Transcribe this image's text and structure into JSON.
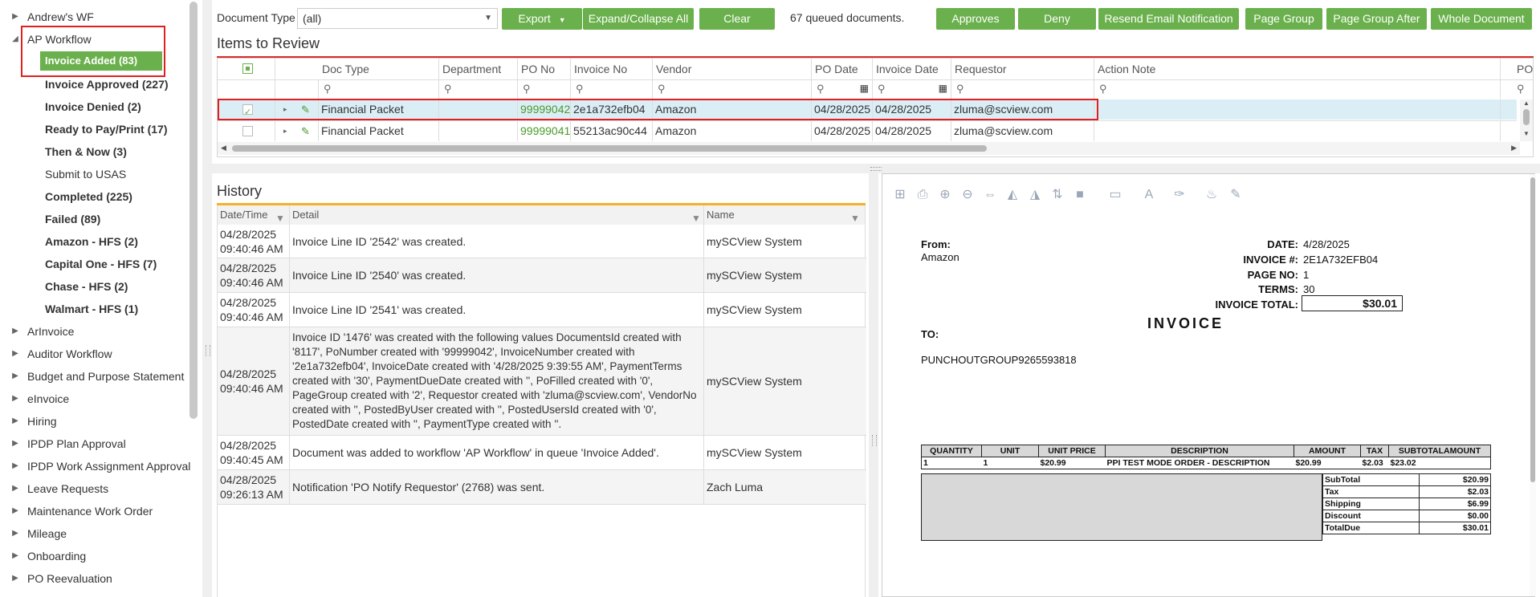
{
  "sidebar": {
    "items": [
      {
        "label": "Andrew's WF",
        "state": "collapsed"
      },
      {
        "label": "AP Workflow",
        "state": "expanded"
      },
      {
        "label": "ArInvoice",
        "state": "collapsed"
      },
      {
        "label": "Auditor Workflow",
        "state": "collapsed"
      },
      {
        "label": "Budget and Purpose Statement",
        "state": "collapsed"
      },
      {
        "label": "eInvoice",
        "state": "collapsed"
      },
      {
        "label": "Hiring",
        "state": "collapsed"
      },
      {
        "label": "IPDP Plan Approval",
        "state": "collapsed"
      },
      {
        "label": "IPDP Work Assignment Approval",
        "state": "collapsed"
      },
      {
        "label": "Leave Requests",
        "state": "collapsed"
      },
      {
        "label": "Maintenance Work Order",
        "state": "collapsed"
      },
      {
        "label": "Mileage",
        "state": "collapsed"
      },
      {
        "label": "Onboarding",
        "state": "collapsed"
      },
      {
        "label": "PO Reevaluation",
        "state": "collapsed"
      }
    ],
    "queues": [
      {
        "label": "Invoice Added (83)",
        "selected": true
      },
      {
        "label": "Invoice Approved (227)"
      },
      {
        "label": "Invoice Denied (2)"
      },
      {
        "label": "Ready to Pay/Print (17)"
      },
      {
        "label": "Then & Now (3)"
      },
      {
        "label": "Submit to USAS"
      },
      {
        "label": "Completed (225)"
      },
      {
        "label": "Failed (89)"
      },
      {
        "label": "Amazon - HFS (2)"
      },
      {
        "label": "Capital One - HFS (7)"
      },
      {
        "label": "Chase - HFS (2)"
      },
      {
        "label": "Walmart - HFS (1)"
      }
    ]
  },
  "toolbar": {
    "doc_type_label": "Document Type",
    "doc_type_value": "(all)",
    "export_label": "Export",
    "expand_label": "Expand/Collapse All",
    "clear_label": "Clear",
    "queued_text": "67 queued documents.",
    "approves_label": "Approves",
    "deny_label": "Deny",
    "resend_label": "Resend Email Notification",
    "page_group_label": "Page Group",
    "page_group_after_label": "Page Group After",
    "whole_document_label": "Whole Document"
  },
  "review": {
    "title": "Items to Review",
    "columns": [
      "Doc Type",
      "Department",
      "PO No",
      "Invoice No",
      "Vendor",
      "PO Date",
      "Invoice Date",
      "Requestor",
      "Action Note",
      "PO"
    ],
    "rows": [
      {
        "doc_type": "Financial Packet",
        "department": "",
        "po_no": "99999042",
        "invoice_no": "2e1a732efb04",
        "vendor": "Amazon",
        "po_date": "04/28/2025",
        "invoice_date": "04/28/2025",
        "requestor": "zluma@scview.com",
        "action_note": "",
        "selected": true
      },
      {
        "doc_type": "Financial Packet",
        "department": "",
        "po_no": "99999041",
        "invoice_no": "55213ac90c44",
        "vendor": "Amazon",
        "po_date": "04/28/2025",
        "invoice_date": "04/28/2025",
        "requestor": "zluma@scview.com",
        "action_note": "",
        "selected": false
      }
    ]
  },
  "history": {
    "title": "History",
    "columns": [
      "Date/Time",
      "Detail",
      "Name"
    ],
    "rows": [
      {
        "date": "04/28/2025",
        "time": "09:40:46 AM",
        "detail": "Invoice Line ID '2542' was created.",
        "name": "mySCView System"
      },
      {
        "date": "04/28/2025",
        "time": "09:40:46 AM",
        "detail": "Invoice Line ID '2540' was created.",
        "name": "mySCView System"
      },
      {
        "date": "04/28/2025",
        "time": "09:40:46 AM",
        "detail": "Invoice Line ID '2541' was created.",
        "name": "mySCView System"
      },
      {
        "date": "04/28/2025",
        "time": "09:40:46 AM",
        "detail": "Invoice ID '1476' was created with the following values DocumentsId created with '8117', PoNumber created with '99999042', InvoiceNumber created with '2e1a732efb04', InvoiceDate created with '4/28/2025 9:39:55 AM', PaymentTerms created with '30', PaymentDueDate created with '', PoFilled created with '0', PageGroup created with '2', Requestor created with 'zluma@scview.com', VendorNo created with '', PostedByUser created with '', PostedUsersId created with '0', PostedDate created with '', PaymentType created with ''.",
        "name": "mySCView System"
      },
      {
        "date": "04/28/2025",
        "time": "09:40:45 AM",
        "detail": "Document was added to workflow 'AP Workflow' in queue 'Invoice Added'.",
        "name": "mySCView System"
      },
      {
        "date": "04/28/2025",
        "time": "09:26:13 AM",
        "detail": "Notification 'PO Notify Requestor' (2768) was sent.",
        "name": "Zach Luma"
      }
    ]
  },
  "invoice": {
    "from_label": "From:",
    "from_value": "Amazon",
    "to_label": "TO:",
    "to_value": "PUNCHOUTGROUP9265593818",
    "title": "INVOICE",
    "meta": [
      {
        "label": "DATE:",
        "value": "4/28/2025"
      },
      {
        "label": "INVOICE #:",
        "value": "2E1A732EFB04"
      },
      {
        "label": "PAGE NO:",
        "value": "1"
      },
      {
        "label": "TERMS:",
        "value": "30"
      }
    ],
    "total_label": "INVOICE TOTAL:",
    "total_value": "$30.01",
    "table_headers": [
      "QUANTITY",
      "UNIT",
      "UNIT PRICE",
      "DESCRIPTION",
      "AMOUNT",
      "TAX",
      "SUBTOTALAMOUNT"
    ],
    "line": {
      "quantity": "1",
      "unit": "1",
      "unit_price": "$20.99",
      "description": "PPI TEST MODE ORDER - DESCRIPTION",
      "amount": "$20.99",
      "tax": "$2.03",
      "subtotal": "$23.02"
    },
    "summary": [
      {
        "label": "SubTotal",
        "value": "$20.99"
      },
      {
        "label": "Tax",
        "value": "$2.03"
      },
      {
        "label": "Shipping",
        "value": "$6.99"
      },
      {
        "label": "Discount",
        "value": "$0.00"
      },
      {
        "label": "TotalDue",
        "value": "$30.01"
      }
    ]
  },
  "colors": {
    "accent": "#6ab04c",
    "highlight": "#e02020",
    "row_selected": "#dbeef6",
    "history_line": "#f3b128"
  }
}
